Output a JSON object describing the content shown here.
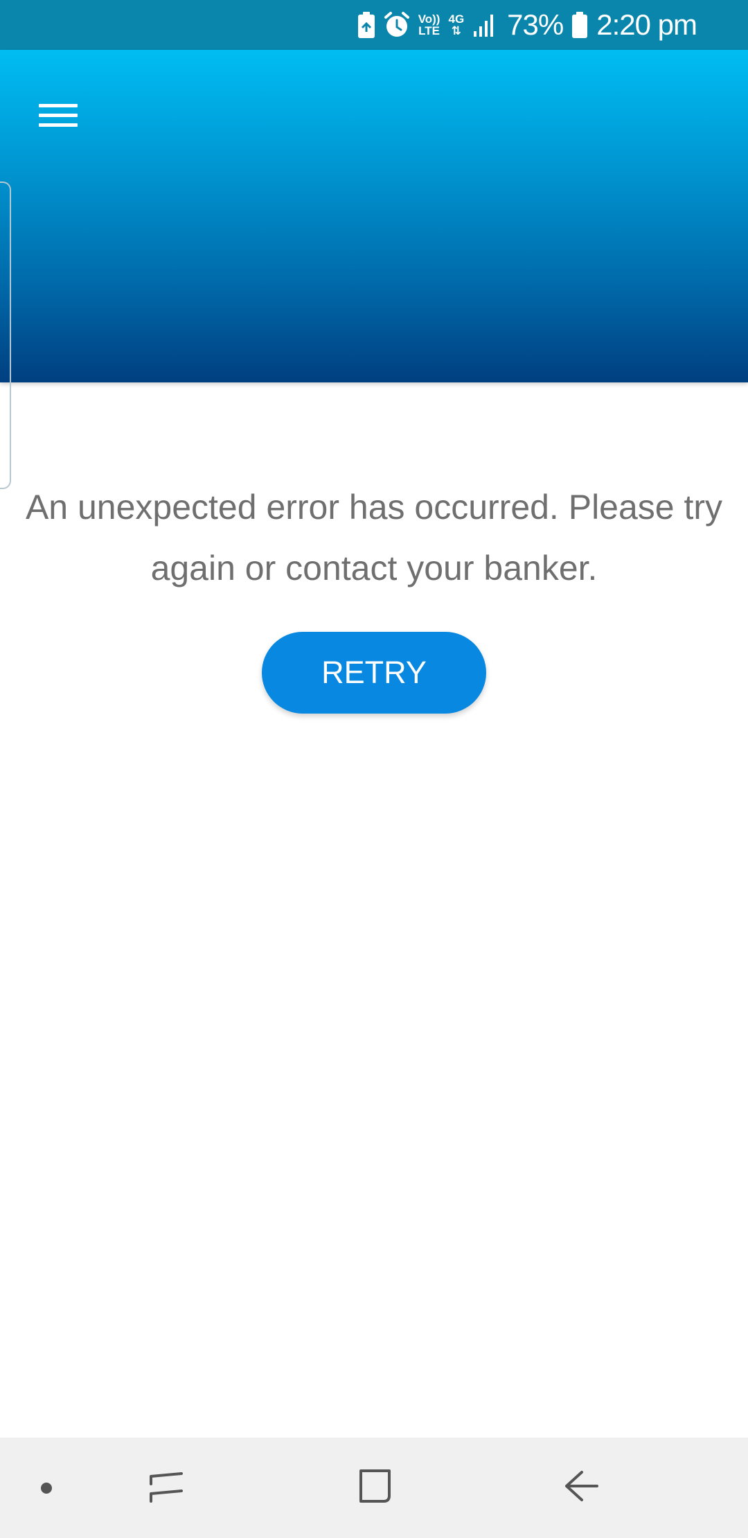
{
  "status_bar": {
    "battery_percent": "73%",
    "time": "2:20 pm",
    "network": "4G",
    "volte": {
      "top": "Vo))",
      "bottom": "LTE"
    },
    "icons": [
      "battery-saver-icon",
      "alarm-icon",
      "volte-icon",
      "network-4g-icon",
      "signal-icon",
      "battery-icon"
    ]
  },
  "header": {
    "menu_icon": "hamburger-menu-icon"
  },
  "content": {
    "error_line1": "An unexpected error has occurred. Please try",
    "error_line2": "again or contact your banker.",
    "retry_label": "RETRY"
  },
  "nav_bar": {
    "icons": [
      "dot-icon",
      "recent-apps-icon",
      "home-icon",
      "back-icon"
    ]
  },
  "colors": {
    "status_bar": "#0a86ad",
    "header_top": "#00bdf2",
    "header_bottom": "#003f80",
    "button": "#0888e0",
    "error_text": "#6f6f6f",
    "nav_bar": "#f0f0f0"
  }
}
